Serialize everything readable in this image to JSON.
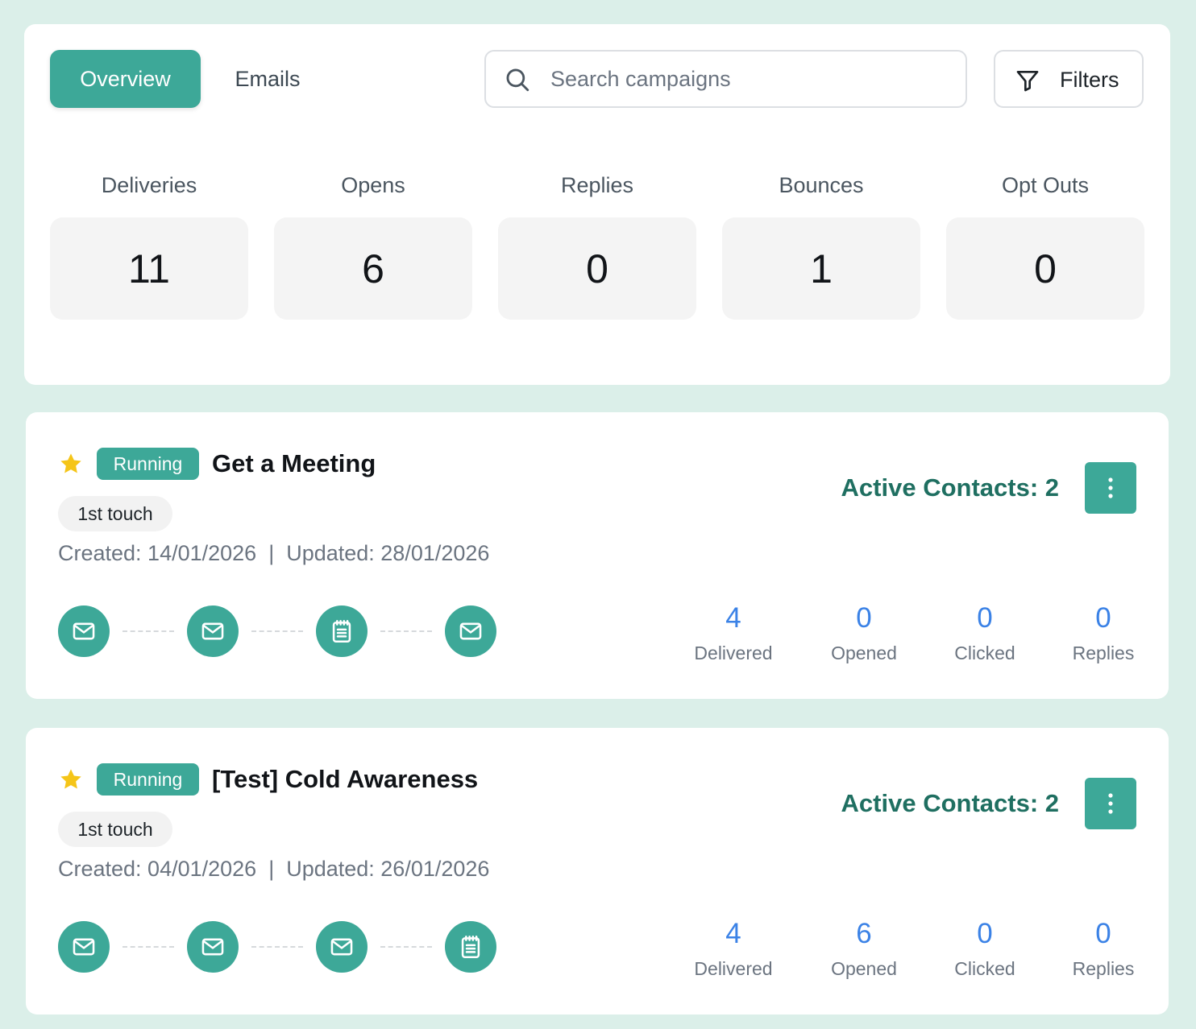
{
  "tabs": [
    {
      "label": "Overview",
      "active": true
    },
    {
      "label": "Emails",
      "active": false
    }
  ],
  "search": {
    "placeholder": "Search campaigns",
    "value": ""
  },
  "filters": {
    "label": "Filters"
  },
  "stats": [
    {
      "label": "Deliveries",
      "value": "11"
    },
    {
      "label": "Opens",
      "value": "6"
    },
    {
      "label": "Replies",
      "value": "0"
    },
    {
      "label": "Bounces",
      "value": "1"
    },
    {
      "label": "Opt Outs",
      "value": "0"
    }
  ],
  "campaigns": [
    {
      "starred": true,
      "status": "Running",
      "title": "Get a Meeting",
      "touch": "1st touch",
      "dates": "Created: 14/01/2026  |  Updated: 28/01/2026",
      "active_contacts": "Active Contacts: 2",
      "steps": [
        "mail-icon",
        "mail-icon",
        "task-icon",
        "mail-icon"
      ],
      "metrics": [
        {
          "value": "4",
          "label": "Delivered"
        },
        {
          "value": "0",
          "label": "Opened"
        },
        {
          "value": "0",
          "label": "Clicked"
        },
        {
          "value": "0",
          "label": "Replies"
        }
      ]
    },
    {
      "starred": true,
      "status": "Running",
      "title": "[Test] Cold Awareness",
      "touch": "1st touch",
      "dates": "Created: 04/01/2026  |  Updated: 26/01/2026",
      "active_contacts": "Active Contacts: 2",
      "steps": [
        "mail-icon",
        "mail-icon",
        "mail-icon",
        "task-icon"
      ],
      "metrics": [
        {
          "value": "4",
          "label": "Delivered"
        },
        {
          "value": "6",
          "label": "Opened"
        },
        {
          "value": "0",
          "label": "Clicked"
        },
        {
          "value": "0",
          "label": "Replies"
        }
      ]
    }
  ],
  "colors": {
    "accent": "#3da898",
    "metric_number": "#3b82e6",
    "active_contacts": "#1f6f61",
    "star": "#f5c518",
    "page_background": "#dbefe9"
  }
}
